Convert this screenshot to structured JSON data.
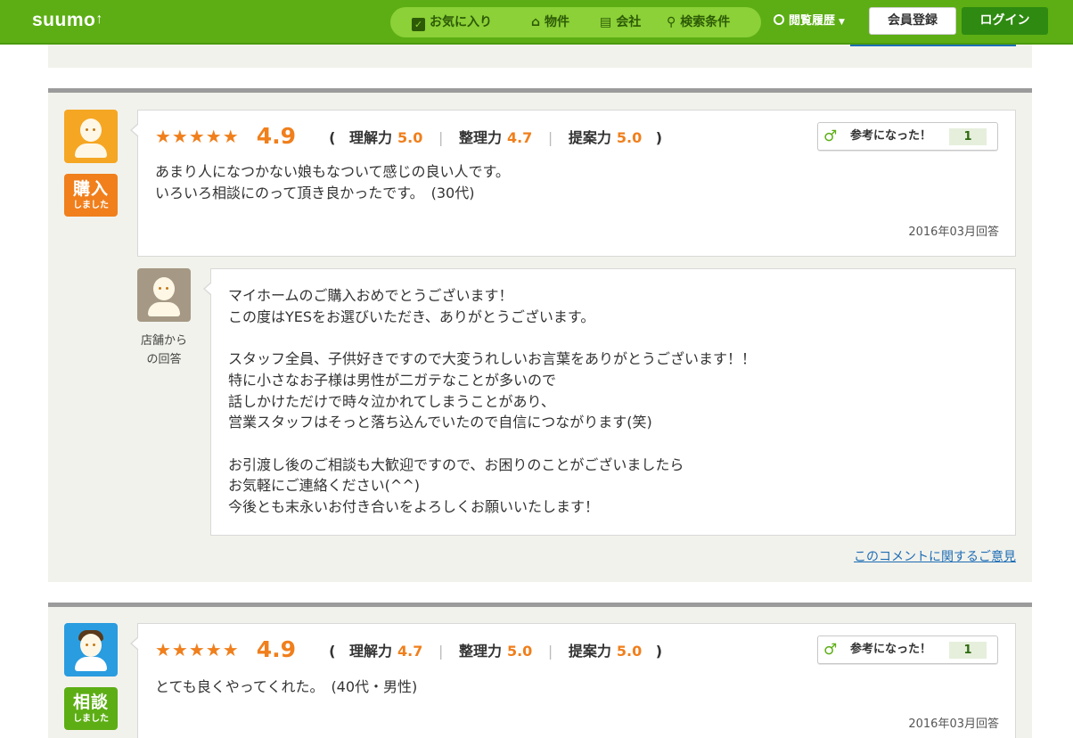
{
  "header": {
    "logo": "suumo",
    "nav": [
      {
        "label": "お気に入り",
        "icon": "checkbox-icon"
      },
      {
        "label": "物件",
        "icon": "house-icon"
      },
      {
        "label": "会社",
        "icon": "building-icon"
      },
      {
        "label": "検索条件",
        "icon": "search-icon"
      }
    ],
    "history_label": "閲覧履歴",
    "register_label": "会員登録",
    "login_label": "ログイン"
  },
  "reviews": [
    {
      "stars": "★★★★★",
      "score": "4.9",
      "subratings": [
        {
          "label": "理解力",
          "value": "5.0"
        },
        {
          "label": "整理力",
          "value": "4.7"
        },
        {
          "label": "提案力",
          "value": "5.0"
        }
      ],
      "helpful_label": "参考になった！",
      "helpful_count": "1",
      "comment": "あまり人になつかない娘もなついて感じの良い人です。\nいろいろ相談にのって頂き良かったです。　(30代)",
      "date": "2016年03月回答",
      "badge_main": "購入",
      "badge_sub": "しました",
      "badge_color": "#f07f1c",
      "avatar_color": "#f5a623",
      "reply": {
        "caption": "店舗からの回答",
        "text": "マイホームのご購入おめでとうございます！\nこの度はYESをお選びいただき、ありがとうございます。\n\nスタッフ全員、子供好きですので大変うれしいお言葉をありがとうございます！！\n特に小さなお子様は男性が二ガテなことが多いので\n話しかけただけで時々泣かれてしまうことがあり、\n営業スタッフはそっと落ち込んでいたので自信につながります(笑)\n\nお引渡し後のご相談も大歓迎ですので、お困りのことがございましたら\nお気軽にご連絡ください(^^)\n今後とも末永いお付き合いをよろしくお願いいたします！"
      },
      "opinion_link": "このコメントに関するご意見"
    },
    {
      "stars": "★★★★★",
      "score": "4.9",
      "subratings": [
        {
          "label": "理解力",
          "value": "4.7"
        },
        {
          "label": "整理力",
          "value": "5.0"
        },
        {
          "label": "提案力",
          "value": "5.0"
        }
      ],
      "helpful_label": "参考になった！",
      "helpful_count": "1",
      "comment": "とても良くやってくれた。　(40代・男性)",
      "date": "2016年03月回答",
      "badge_main": "相談",
      "badge_sub": "しました",
      "badge_color": "#5cae14",
      "avatar_color": "#2a9ce0"
    }
  ]
}
